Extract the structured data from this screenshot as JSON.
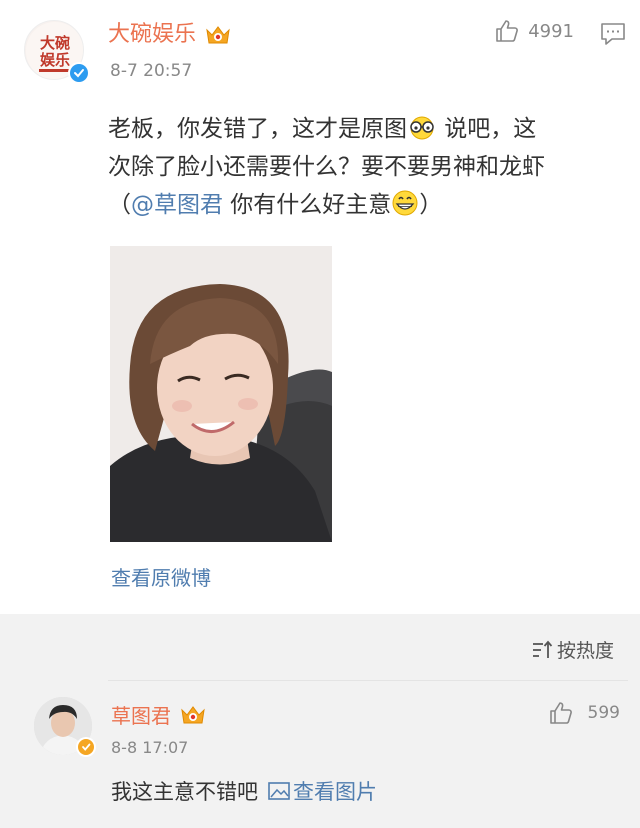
{
  "post": {
    "author": "大碗娱乐",
    "avatar_text": "大碗娱乐",
    "timestamp": "8-7 20:57",
    "like_count": "4991",
    "text_line1_a": "老板，你发错了，这才是原图",
    "text_line1_b": " 说吧，这",
    "text_line2": "次除了脸小还需要什么？要不要男神和龙虾",
    "text_line3_open": "（",
    "text_line3_mention": "@草图君",
    "text_line3_rest": " 你有什么好主意",
    "text_line3_close": "）",
    "view_original": "查看原微博"
  },
  "comments_header": {
    "sort_label": "按热度"
  },
  "comment": {
    "author": "草图君",
    "timestamp": "8-8 17:07",
    "like_count": "599",
    "text": "我这主意不错吧",
    "link_text": "查看图片"
  },
  "colors": {
    "username": "#eb7350",
    "link": "#507daf",
    "meta": "#888888",
    "verified_blue": "#2d9cf0",
    "badge_orange": "#f5a623"
  },
  "icons": {
    "verified": "verified-badge-icon",
    "vip": "vip-crown-icon",
    "like": "thumbs-up-icon",
    "comment": "comment-bubble-icon",
    "sort": "sort-icon",
    "image_link": "image-icon"
  }
}
